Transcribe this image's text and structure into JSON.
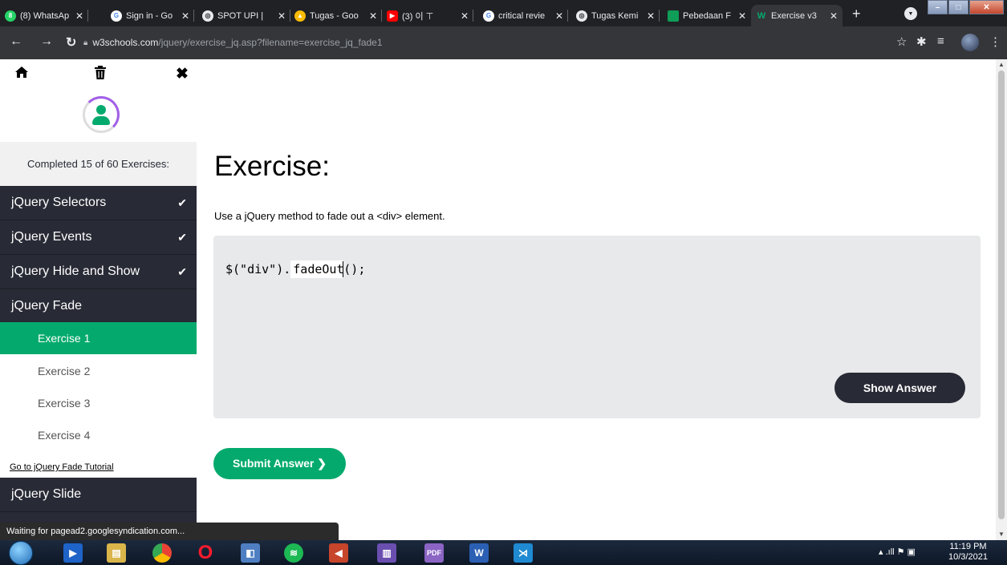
{
  "browser": {
    "tabs": [
      {
        "label": "(8) WhatsAp",
        "icon": "whatsapp-icon",
        "color": "#25d366"
      },
      {
        "label": "Sign in - Go",
        "icon": "google-icon",
        "color": "#ffffff"
      },
      {
        "label": "SPOT UPI |",
        "icon": "globe-icon",
        "color": "#e8eaed"
      },
      {
        "label": "Tugas - Goo",
        "icon": "google-drive-icon",
        "color": "#fbbc04"
      },
      {
        "label": "(3) 이 ⊤",
        "icon": "youtube-icon",
        "color": "#ff0000"
      },
      {
        "label": "critical revie",
        "icon": "google-icon",
        "color": "#ffffff"
      },
      {
        "label": "Tugas Kemi",
        "icon": "globe-icon",
        "color": "#e8eaed"
      },
      {
        "label": "Pebedaan F",
        "icon": "sheet-icon",
        "color": "#0f9d58"
      },
      {
        "label": "Exercise v3",
        "icon": "w3schools-icon",
        "color": "#04aa6d"
      }
    ],
    "url_host": "w3schools.com",
    "url_path": "/jquery/exercise_jq.asp?filename=exercise_jq_fade1"
  },
  "sidebar": {
    "completed_text": "Completed 15 of 60 Exercises:",
    "categories": [
      {
        "label": "jQuery Selectors",
        "done": true
      },
      {
        "label": "jQuery Events",
        "done": true
      },
      {
        "label": "jQuery Hide and Show",
        "done": true
      },
      {
        "label": "jQuery Fade",
        "done": false
      },
      {
        "label": "jQuery Slide",
        "done": false
      }
    ],
    "check_glyph": "✔",
    "exercises": [
      "Exercise 1",
      "Exercise 2",
      "Exercise 3",
      "Exercise 4"
    ],
    "tutorial_link": "Go to jQuery Fade Tutorial"
  },
  "main": {
    "title": "Exercise:",
    "description": "Use a jQuery method to fade out a <div> element.",
    "code_prefix": "$(\"div\").",
    "code_answer": "fadeOut",
    "code_suffix": "();",
    "show_answer_label": "Show Answer",
    "submit_label": "Submit Answer ❯"
  },
  "status_text": "Waiting for pagead2.googlesyndication.com...",
  "taskbar": {
    "time": "11:19 PM",
    "date": "10/3/2021"
  },
  "colors": {
    "accent": "#04aa6d",
    "sidebar_dark": "#282a35",
    "progress_arc": "#a25fe8"
  }
}
